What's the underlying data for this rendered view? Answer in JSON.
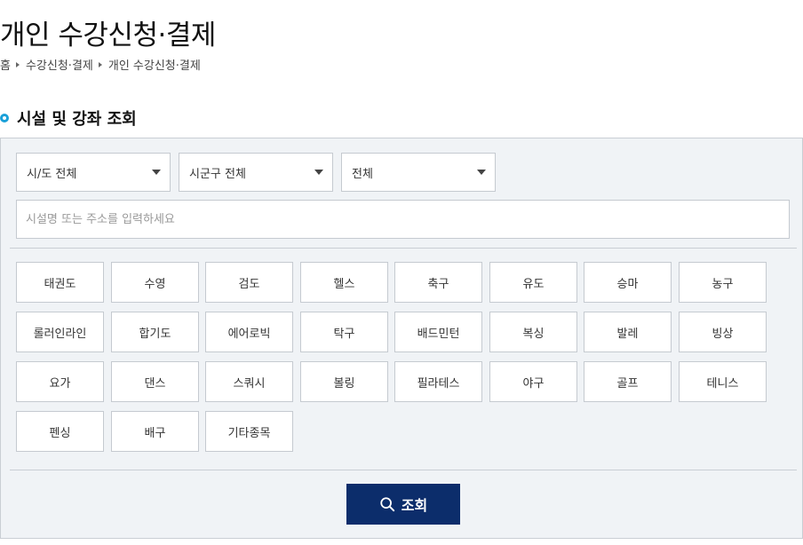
{
  "page": {
    "title": "개인 수강신청·결제",
    "breadcrumb": [
      "홈",
      "수강신청·결제",
      "개인 수강신청·결제"
    ]
  },
  "section": {
    "title": "시설 및 강좌 조회"
  },
  "filters": {
    "sido": "시/도 전체",
    "sigungu": "시군구 전체",
    "category": "전체"
  },
  "search": {
    "placeholder": "시설명 또는 주소를 입력하세요",
    "value": ""
  },
  "sports": [
    [
      "태권도",
      "수영",
      "검도",
      "헬스",
      "축구",
      "유도",
      "승마",
      "농구"
    ],
    [
      "롤러인라인",
      "합기도",
      "에어로빅",
      "탁구",
      "배드민턴",
      "복싱",
      "발레",
      "빙상"
    ],
    [
      "요가",
      "댄스",
      "스쿼시",
      "볼링",
      "필라테스",
      "야구",
      "골프",
      "테니스"
    ],
    [
      "펜싱",
      "배구",
      "기타종목"
    ]
  ],
  "submit": {
    "label": "조회",
    "icon": "search-icon",
    "color": "#0c2d6b"
  },
  "colors": {
    "accent": "#1aa0d8",
    "panel": "#f0f3f6"
  }
}
